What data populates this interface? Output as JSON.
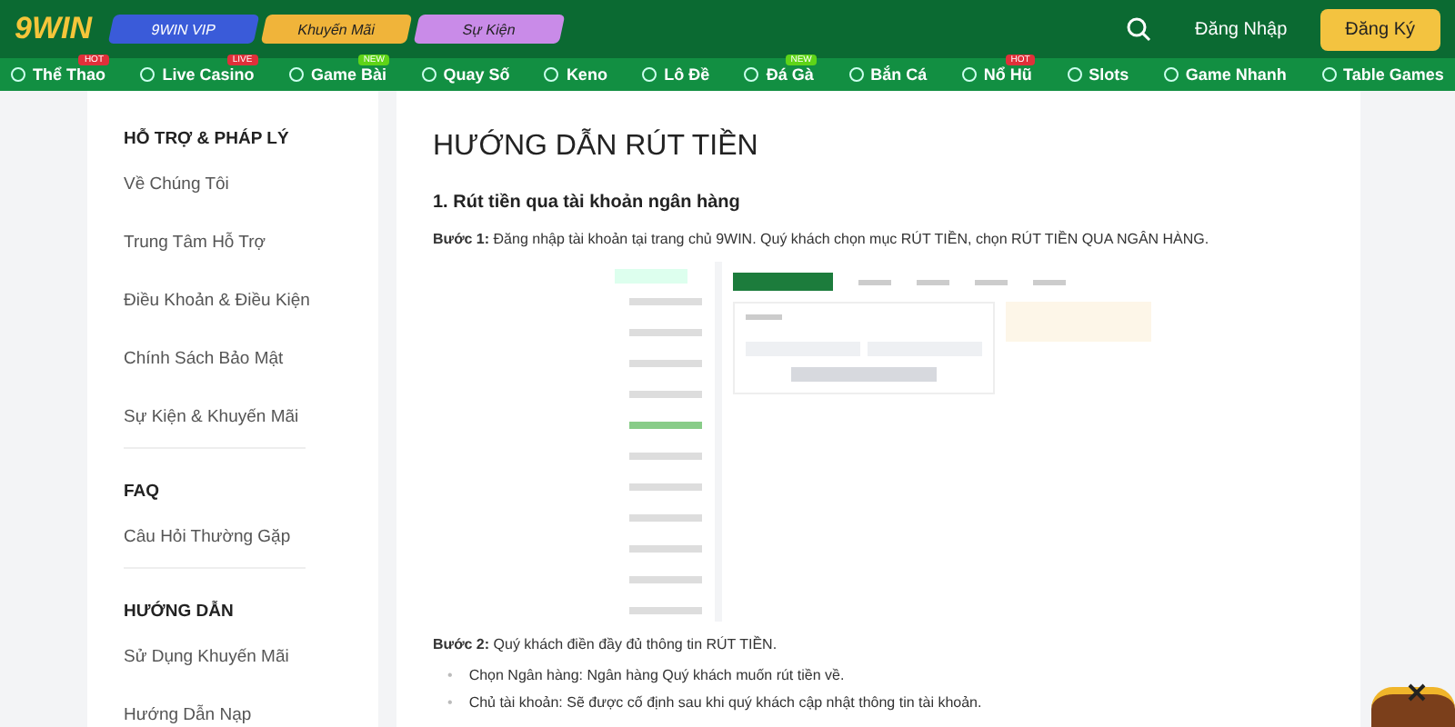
{
  "header": {
    "logo": "9WIN",
    "promos": [
      {
        "label": "9WIN VIP",
        "color": "#3a5bd9"
      },
      {
        "label": "Khuyến Mãi",
        "color": "#f0b43a"
      },
      {
        "label": "Sự Kiện",
        "color": "#c98be8"
      }
    ],
    "login": "Đăng Nhập",
    "register": "Đăng Ký"
  },
  "nav": [
    {
      "label": "Thể Thao",
      "badge": "HOT",
      "color": "#e0303a"
    },
    {
      "label": "Live Casino",
      "badge": "LIVE",
      "color": "#e0303a"
    },
    {
      "label": "Game Bài",
      "badge": "NEW",
      "color": "#5fd418"
    },
    {
      "label": "Quay Số"
    },
    {
      "label": "Keno"
    },
    {
      "label": "Lô Đề"
    },
    {
      "label": "Đá Gà",
      "badge": "NEW",
      "color": "#5fd418"
    },
    {
      "label": "Bắn Cá"
    },
    {
      "label": "Nổ Hũ",
      "badge": "HOT",
      "color": "#e0303a"
    },
    {
      "label": "Slots"
    },
    {
      "label": "Game Nhanh"
    },
    {
      "label": "Table Games"
    }
  ],
  "sidebar": [
    {
      "title": "HỖ TRỢ & PHÁP LÝ",
      "items": [
        "Về Chúng Tôi",
        "Trung Tâm Hỗ Trợ",
        "Điều Khoản & Điều Kiện",
        "Chính Sách Bảo Mật",
        "Sự Kiện & Khuyến Mãi"
      ]
    },
    {
      "title": "FAQ",
      "items": [
        "Câu Hỏi Thường Gặp"
      ]
    },
    {
      "title": "HƯỚNG DẪN",
      "items": [
        "Sử Dụng Khuyến Mãi",
        "Hướng Dẫn Nạp"
      ]
    }
  ],
  "article": {
    "title": "HƯỚNG DẪN RÚT TIỀN",
    "subtitle": "1. Rút tiền qua tài khoản ngân hàng",
    "step1": "**Bước 1:** Đăng nhập tài khoản tại trang chủ 9WIN. Quý khách chọn mục RÚT TIỀN, chọn RÚT TIỀN QUA NGÂN HÀNG.",
    "step2": "**Bước 2:** Quý khách điền đầy đủ thông tin RÚT TIỀN.",
    "bullets": [
      {
        "marker": "•",
        "text": "Chọn Ngân hàng: Ngân hàng Quý khách muốn rút tiền về."
      },
      {
        "marker": "•",
        "text": "Chủ tài khoản: Sẽ được cố định sau khi quý khách cập nhật thông tin tài khoản."
      }
    ]
  }
}
